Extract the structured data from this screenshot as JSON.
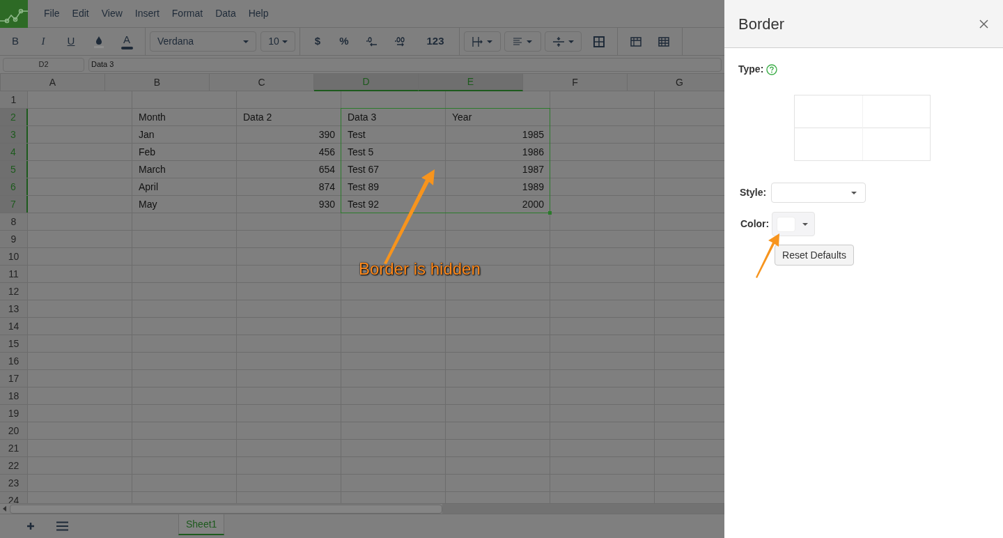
{
  "menu": [
    "File",
    "Edit",
    "View",
    "Insert",
    "Format",
    "Data",
    "Help"
  ],
  "toolbar": {
    "bold": "B",
    "italic": "I",
    "underline": "U",
    "font_color": "A",
    "font": "Verdana",
    "size": "10",
    "currency": "$",
    "percent": "%",
    "number": "123"
  },
  "formula_bar": {
    "cell": "D2",
    "value": "Data 3"
  },
  "table": {
    "columns": [
      {
        "label": "A",
        "selected": false
      },
      {
        "label": "B",
        "selected": false
      },
      {
        "label": "C",
        "selected": false
      },
      {
        "label": "D",
        "selected": true
      },
      {
        "label": "E",
        "selected": true
      },
      {
        "label": "F",
        "selected": false
      },
      {
        "label": "G",
        "selected": false
      }
    ],
    "rows": [
      {
        "label": "1",
        "selected": false
      },
      {
        "label": "2",
        "selected": true,
        "cells": [
          null,
          {
            "text": "Month",
            "kind": "text"
          },
          {
            "text": "Data 2",
            "kind": "text"
          },
          {
            "text": "Data 3",
            "kind": "text"
          },
          {
            "text": "Year",
            "kind": "text"
          }
        ]
      },
      {
        "label": "3",
        "selected": true,
        "cells": [
          null,
          {
            "text": "Jan",
            "kind": "text"
          },
          {
            "text": "390",
            "kind": "number"
          },
          {
            "text": "Test",
            "kind": "text"
          },
          {
            "text": "1985",
            "kind": "number"
          }
        ]
      },
      {
        "label": "4",
        "selected": true,
        "cells": [
          null,
          {
            "text": "Feb",
            "kind": "text"
          },
          {
            "text": "456",
            "kind": "number"
          },
          {
            "text": "Test 5",
            "kind": "text"
          },
          {
            "text": "1986",
            "kind": "number"
          }
        ]
      },
      {
        "label": "5",
        "selected": true,
        "cells": [
          null,
          {
            "text": "March",
            "kind": "text"
          },
          {
            "text": "654",
            "kind": "number"
          },
          {
            "text": "Test 67",
            "kind": "text"
          },
          {
            "text": "1987",
            "kind": "number"
          }
        ]
      },
      {
        "label": "6",
        "selected": true,
        "cells": [
          null,
          {
            "text": "April",
            "kind": "text"
          },
          {
            "text": "874",
            "kind": "number"
          },
          {
            "text": "Test 89",
            "kind": "text"
          },
          {
            "text": "1989",
            "kind": "number"
          }
        ]
      },
      {
        "label": "7",
        "selected": true,
        "cells": [
          null,
          {
            "text": "May",
            "kind": "text"
          },
          {
            "text": "930",
            "kind": "number"
          },
          {
            "text": "Test 92",
            "kind": "text"
          },
          {
            "text": "2000",
            "kind": "number"
          }
        ]
      },
      {
        "label": "8",
        "selected": false
      },
      {
        "label": "9",
        "selected": false
      },
      {
        "label": "10",
        "selected": false
      },
      {
        "label": "11",
        "selected": false
      },
      {
        "label": "12",
        "selected": false
      },
      {
        "label": "13",
        "selected": false
      },
      {
        "label": "14",
        "selected": false
      },
      {
        "label": "15",
        "selected": false
      },
      {
        "label": "16",
        "selected": false
      },
      {
        "label": "17",
        "selected": false
      },
      {
        "label": "18",
        "selected": false
      },
      {
        "label": "19",
        "selected": false
      },
      {
        "label": "20",
        "selected": false
      },
      {
        "label": "21",
        "selected": false
      },
      {
        "label": "22",
        "selected": false
      },
      {
        "label": "23",
        "selected": false
      },
      {
        "label": "24",
        "selected": false
      }
    ]
  },
  "sheet_tabs": [
    {
      "label": "Sheet1",
      "selected": true
    }
  ],
  "annotation": {
    "callout": "Border is hidden"
  },
  "border_panel": {
    "title": "Border",
    "type_label": "Type:",
    "style_label": "Style:",
    "color_label": "Color:",
    "reset_button": "Reset Defaults"
  }
}
